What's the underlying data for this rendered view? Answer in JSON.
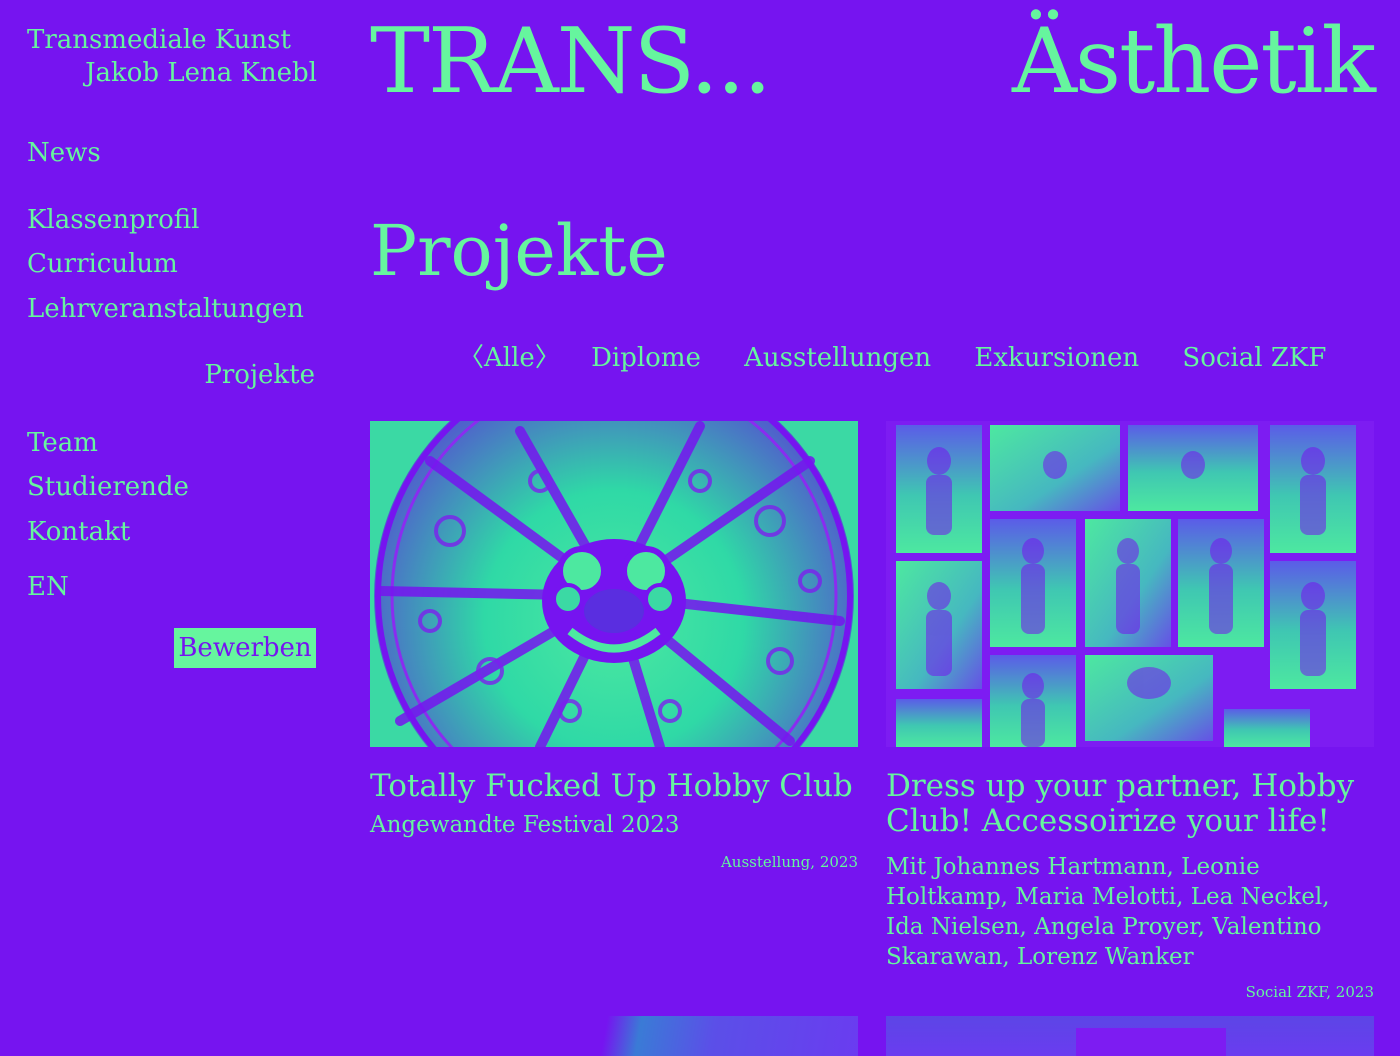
{
  "brand": {
    "line1": "Transmediale Kunst",
    "line2": "Jakob Lena Knebl"
  },
  "header": {
    "title_left": "TRANS...",
    "title_right": "Ästhetik"
  },
  "nav": {
    "news": "News",
    "klassenprofil": "Klassenprofil",
    "curriculum": "Curriculum",
    "lehrveranstaltungen": "Lehrveranstaltungen",
    "projekte": "Projekte",
    "team": "Team",
    "studierende": "Studierende",
    "kontakt": "Kontakt",
    "language": "EN",
    "apply": "Bewerben"
  },
  "page": {
    "heading": "Projekte"
  },
  "filters": {
    "active": "〈Alle〉",
    "items": [
      "Diplome",
      "Ausstellungen",
      "Exkursionen",
      "Social ZKF"
    ]
  },
  "projects": [
    {
      "title": "Totally Fucked Up Hobby Club",
      "subtitle": "Angewandte Festival 2023",
      "meta": "Ausstellung, 2023"
    },
    {
      "title": "Dress up your partner, Hobby Club! Accessoirize your life!",
      "subtitle": "Mit Johannes Hartmann, Leonie Holtkamp, Maria Melotti, Lea Neckel, Ida Nielsen, Angela Proyer, Valentino Skarawan, Lorenz Wanker",
      "meta": "Social ZKF, 2023"
    }
  ],
  "colors": {
    "background": "#7614f0",
    "accent": "#66f59e"
  }
}
